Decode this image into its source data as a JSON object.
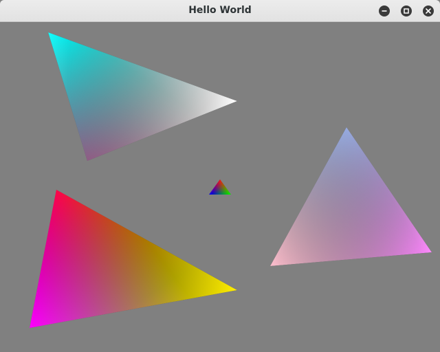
{
  "window": {
    "title": "Hello World",
    "background": "#808080",
    "controls": [
      {
        "name": "minimize",
        "icon": "minimize-icon"
      },
      {
        "name": "maximize",
        "icon": "maximize-icon"
      },
      {
        "name": "close",
        "icon": "close-icon"
      }
    ]
  },
  "scene": {
    "triangles": [
      {
        "name": "cyan-white-triangle",
        "colors": [
          "#00ffff",
          "#ffffff",
          "#800040"
        ]
      },
      {
        "name": "red-yellow-magenta-triangle",
        "colors": [
          "#ff0000",
          "#ffee00",
          "#ff00ff"
        ]
      },
      {
        "name": "blue-violet-pink-triangle",
        "colors": [
          "#8fa8e0",
          "#ff88ff",
          "#ffc0d0"
        ]
      },
      {
        "name": "rgb-small-triangle",
        "colors": [
          "#ff0000",
          "#00ff00",
          "#0000ff"
        ]
      }
    ]
  }
}
